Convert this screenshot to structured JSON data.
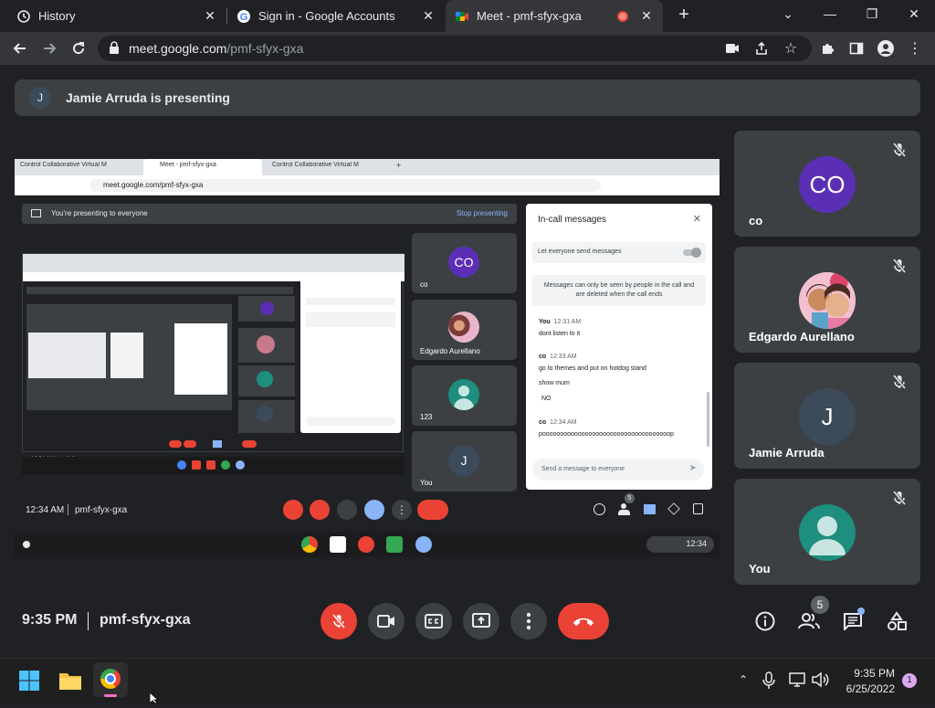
{
  "browser": {
    "tabs": [
      {
        "label": "History",
        "icon": "history-icon"
      },
      {
        "label": "Sign in - Google Accounts",
        "icon": "google-icon"
      },
      {
        "label": "Meet - pmf-sfyx-gxa",
        "icon": "meet-icon",
        "recording": true
      }
    ],
    "new_tab": "+",
    "url_host": "meet.google.com",
    "url_path": "/pmf-sfyx-gxa"
  },
  "meet": {
    "banner": {
      "avatar_initial": "J",
      "text": "Jamie Arruda is presenting"
    },
    "participants": [
      {
        "name": "co",
        "initials": "CO",
        "color": "#5b2fb5",
        "type": "initials"
      },
      {
        "name": "Edgardo Aurellano",
        "type": "photo"
      },
      {
        "name": "Jamie Arruda",
        "initials": "J",
        "color": "#3c4b5a",
        "type": "initials"
      },
      {
        "name": "You",
        "type": "person"
      }
    ],
    "time": "9:35 PM",
    "meeting_code": "pmf-sfyx-gxa",
    "people_count": "5",
    "colors": {
      "end_call": "#ea4335",
      "mic_off": "#ea4335",
      "bg": "#202124",
      "tile": "#3c4043"
    }
  },
  "shared_screen": {
    "tabs": [
      "Control Collaborative Virtual M",
      "Meet - pmf-sfyx-gxa",
      "Control Collaborative Virtual M"
    ],
    "url": "meet.google.com/pmf-sfyx-gxa",
    "presenting_text": "You're presenting to everyone",
    "stop_text": "Stop presenting",
    "tiles": [
      {
        "name": "co",
        "initials": "CO"
      },
      {
        "name": "Edgardo Aurellano",
        "initials": ""
      },
      {
        "name": "123",
        "initials": ""
      },
      {
        "name": "You",
        "initials": "J"
      }
    ],
    "chat": {
      "title": "In-call messages",
      "toggle_label": "Let everyone send messages",
      "notice": "Messages can only be seen by people in the call and are deleted when the call ends",
      "messages": [
        {
          "sender": "You",
          "time": "12:31 AM",
          "lines": [
            "dont listen to it"
          ]
        },
        {
          "sender": "co",
          "time": "12:33 AM",
          "lines": [
            "go to themes and put on hotdog stand",
            "show mum",
            "NO"
          ]
        },
        {
          "sender": "co",
          "time": "12:34 AM",
          "lines": [
            "poooooooooooooooooooooooooooooooooooop"
          ]
        }
      ],
      "input_placeholder": "Send a message to everyone"
    },
    "time": "12:34 AM",
    "meeting_code": "pmf-sfyx-gxa",
    "people_count": "5",
    "shelf_time": "12:34"
  },
  "taskbar": {
    "time": "9:35 PM",
    "date": "6/25/2022",
    "notification_count": "1"
  }
}
